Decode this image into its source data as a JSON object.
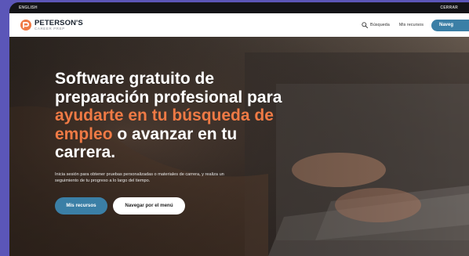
{
  "utility_bar": {
    "left_label": "ENGLISH",
    "right_label": "CERRAR"
  },
  "header": {
    "logo_name": "PETERSON'S",
    "logo_sub": "CAREER PREP",
    "search_label": "Búsqueda",
    "resources_label": "Mis recursos",
    "cta_label": "Naveg"
  },
  "hero": {
    "headline_part1": "Software gratuito de preparación profesional para",
    "headline_accent": "ayudarte en tu búsqueda de empleo",
    "headline_part2": "o avanzar en tu carrera.",
    "subtext": "Inicia sesión para obtener pruebas personalizadas o materiales de carrera, y realiza un seguimiento de tu progreso a lo largo del tiempo.",
    "primary_button": "Mis recursos",
    "secondary_button": "Navegar por el menú"
  },
  "colors": {
    "background": "#5b56b8",
    "accent": "#ef7a45",
    "brand_blue": "#3b7fa6"
  }
}
